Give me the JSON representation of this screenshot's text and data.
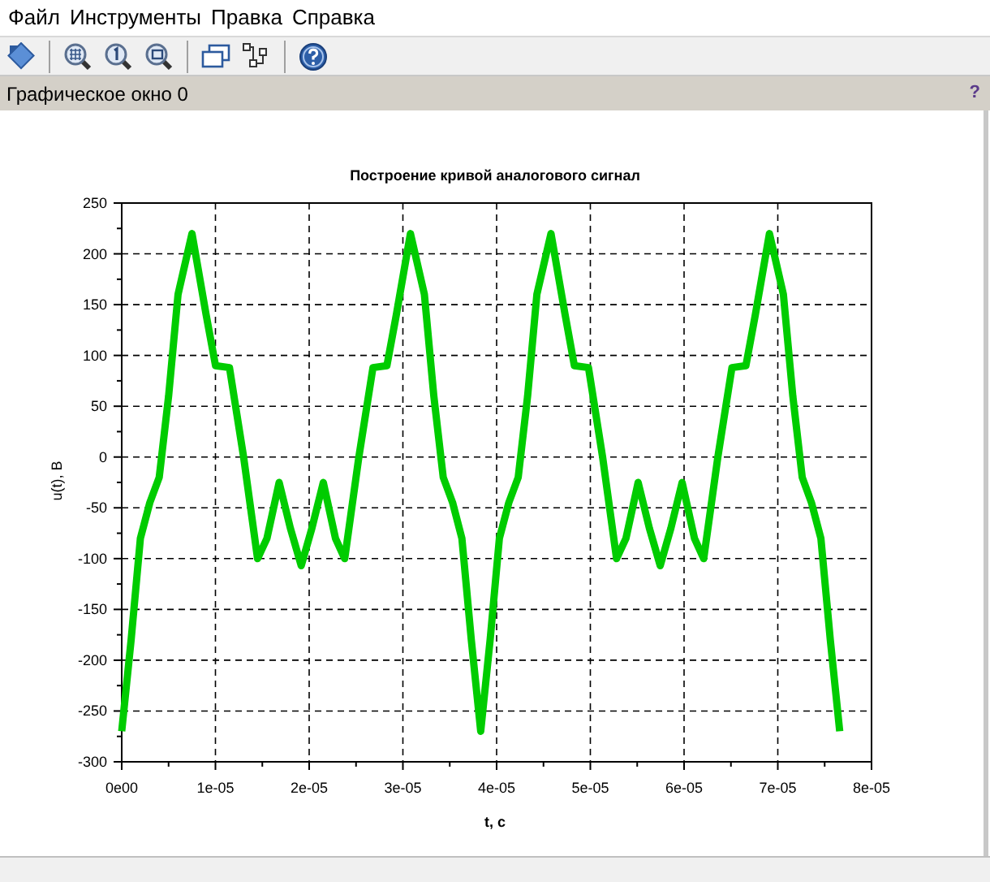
{
  "menu": [
    "Файл",
    "Инструменты",
    "Правка",
    "Справка"
  ],
  "panel": {
    "title": "Графическое окно 0",
    "help": "?"
  },
  "chart_data": {
    "type": "line",
    "title": "Построение кривой аналогового сигнал",
    "xlabel": "t, c",
    "ylabel": "u(t), В",
    "x": [
      0,
      1e-06,
      2e-06,
      3e-06,
      4e-06,
      5e-06,
      6e-06,
      7.5e-06,
      9e-06,
      1e-05,
      1.15e-05,
      1.3e-05,
      1.45e-05,
      1.55e-05,
      1.68e-05,
      1.8e-05,
      1.915e-05,
      2.03e-05,
      2.15e-05,
      2.28e-05,
      2.38e-05,
      2.53e-05,
      2.68e-05,
      2.83e-05,
      2.93e-05,
      3.08e-05,
      3.23e-05,
      3.33e-05,
      3.43e-05,
      3.53e-05,
      3.63e-05,
      3.73e-05,
      3.83e-05,
      3.93e-05,
      4.03e-05,
      4.13e-05,
      4.23e-05,
      4.33e-05,
      4.43e-05,
      4.58e-05,
      4.73e-05,
      4.83e-05,
      4.98e-05,
      5.13e-05,
      5.28e-05,
      5.38e-05,
      5.51e-05,
      5.63e-05,
      5.745e-05,
      5.86e-05,
      5.98e-05,
      6.11e-05,
      6.21e-05,
      6.36e-05,
      6.51e-05,
      6.66e-05,
      6.76e-05,
      6.91e-05,
      7.06e-05,
      7.16e-05,
      7.26e-05,
      7.36e-05,
      7.46e-05,
      7.56e-05,
      7.66e-05
    ],
    "grid": true,
    "series": [
      {
        "color": "#00cc00",
        "values": [
          -270,
          -180,
          -80,
          -45,
          -20,
          60,
          160,
          220,
          140,
          90,
          88,
          0,
          -100,
          -80,
          -25,
          -70,
          -107,
          -70,
          -25,
          -80,
          -100,
          0,
          88,
          90,
          140,
          220,
          160,
          60,
          -20,
          -45,
          -80,
          -180,
          -270,
          -180,
          -80,
          -45,
          -20,
          60,
          160,
          220,
          140,
          90,
          88,
          0,
          -100,
          -80,
          -25,
          -70,
          -107,
          -70,
          -25,
          -80,
          -100,
          0,
          88,
          90,
          140,
          220,
          160,
          60,
          -20,
          -45,
          -80,
          -180,
          -270
        ]
      }
    ],
    "xlim": [
      0,
      8e-05
    ],
    "ylim": [
      -300,
      250
    ],
    "xticks": [
      {
        "value": 0,
        "label": "0e00"
      },
      {
        "value": 1e-05,
        "label": "1e-05"
      },
      {
        "value": 2e-05,
        "label": "2e-05"
      },
      {
        "value": 3e-05,
        "label": "3e-05"
      },
      {
        "value": 4e-05,
        "label": "4e-05"
      },
      {
        "value": 5e-05,
        "label": "5e-05"
      },
      {
        "value": 6e-05,
        "label": "6e-05"
      },
      {
        "value": 7e-05,
        "label": "7e-05"
      },
      {
        "value": 8e-05,
        "label": "8e-05"
      }
    ],
    "yticks": [
      -300,
      -250,
      -200,
      -150,
      -100,
      -50,
      0,
      50,
      100,
      150,
      200,
      250
    ]
  }
}
